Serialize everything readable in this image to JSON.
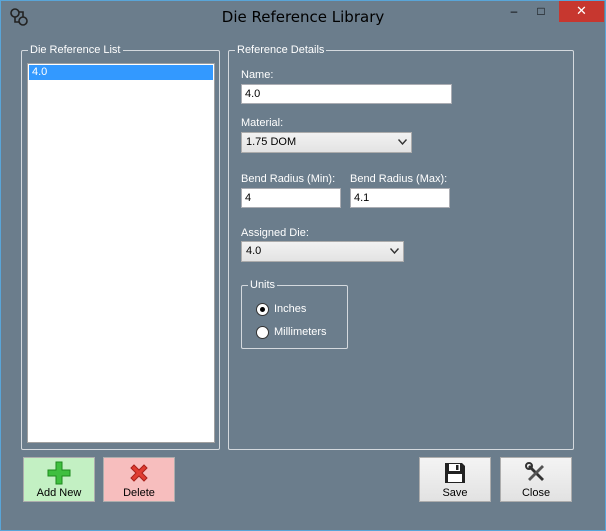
{
  "window": {
    "title": "Die Reference Library",
    "controls": {
      "minimize": "–",
      "maximize": "□",
      "close": "✕"
    }
  },
  "list_panel": {
    "legend": "Die Reference List",
    "items": [
      "4.0"
    ],
    "selected_index": 0
  },
  "details": {
    "legend": "Reference Details",
    "name_label": "Name:",
    "name_value": "4.0",
    "material_label": "Material:",
    "material_value": "1.75 DOM",
    "bend_min_label": "Bend Radius (Min):",
    "bend_min_value": "4",
    "bend_max_label": "Bend Radius (Max):",
    "bend_max_value": "4.1",
    "assigned_die_label": "Assigned Die:",
    "assigned_die_value": "4.0",
    "units": {
      "legend": "Units",
      "options": [
        "Inches",
        "Millimeters"
      ],
      "selected": "Inches"
    }
  },
  "buttons": {
    "add_new": "Add New",
    "delete": "Delete",
    "save": "Save",
    "close": "Close"
  },
  "colors": {
    "form_background": "#6b7d8c",
    "selection": "#3399ff",
    "add_button": "#c3f0c3",
    "delete_button": "#f7bebe",
    "titlebar_close": "#c7372f"
  }
}
